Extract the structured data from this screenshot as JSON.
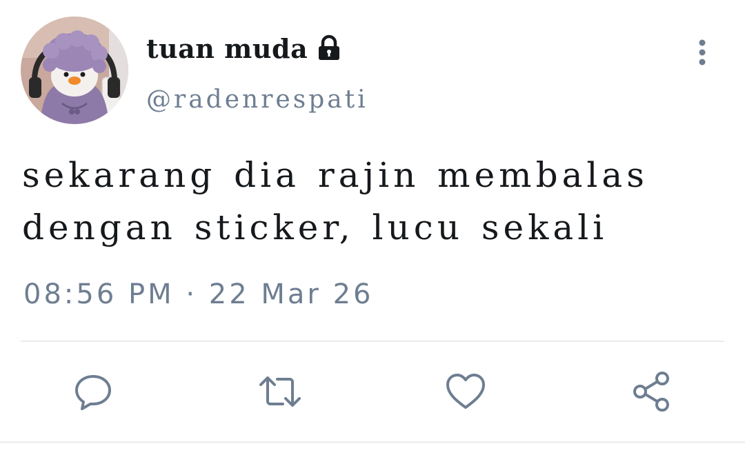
{
  "tweet": {
    "display_name": "tuan muda",
    "handle": "@radenrespati",
    "text": "sekarang dia rajin membalas dengan sticker, lucu sekali",
    "timestamp": "08:56 PM · 22 Mar 26",
    "protected": true
  },
  "icons": {
    "lock": "lock-icon",
    "more": "more-vertical-icon",
    "reply": "reply-icon",
    "retweet": "retweet-icon",
    "like": "heart-icon",
    "share": "share-icon"
  },
  "colors": {
    "text_primary": "#16191c",
    "text_secondary": "#6e7e91",
    "icon": "#6e7e91",
    "divider": "#e9ecef"
  }
}
